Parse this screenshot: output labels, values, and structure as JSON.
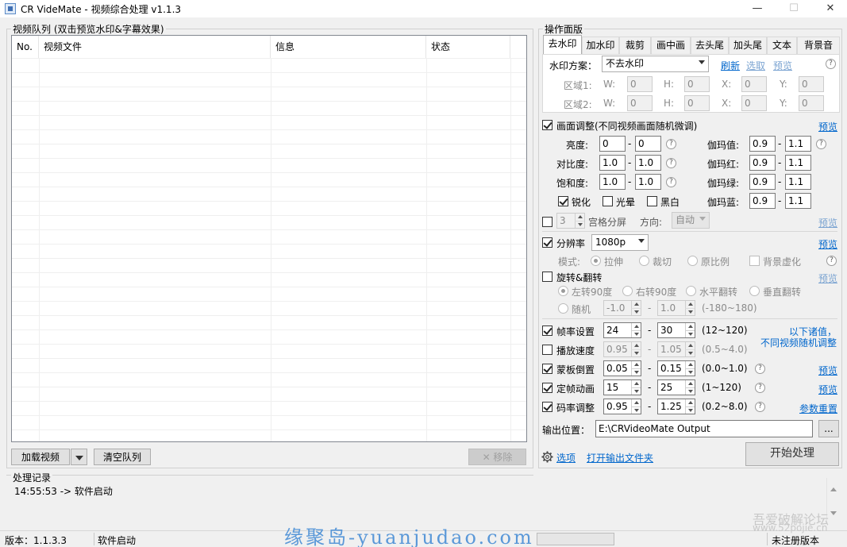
{
  "window": {
    "title": "CR VideMate - 视频综合处理 v1.1.3",
    "minimize": "—",
    "maximize": "☐",
    "close": "✕"
  },
  "queue": {
    "group_label": "视频队列 (双击预览水印&字幕效果)",
    "columns": [
      "No.",
      "视频文件",
      "信息",
      "状态"
    ],
    "load_button": "加载视频",
    "clear_button": "清空队列",
    "remove_button": "✕ 移除"
  },
  "log": {
    "group_label": "处理记录",
    "entries": [
      "14:55:53 -> 软件启动"
    ]
  },
  "status": {
    "version": "版本：1.1.3.3",
    "state": "软件启动",
    "registration": "未注册版本"
  },
  "ops": {
    "group_label": "操作面版",
    "tabs": [
      "去水印",
      "加水印",
      "裁剪",
      "画中画",
      "去头尾",
      "加头尾",
      "文本",
      "背景音"
    ],
    "watermark": {
      "scheme_label": "水印方案：",
      "scheme_value": "不去水印",
      "refresh": "刷新",
      "select": "选取",
      "preview": "预览",
      "region1": "区域1:",
      "region2": "区域2:",
      "w": "W:",
      "h": "H:",
      "x": "X:",
      "y": "Y:",
      "zero": "0"
    },
    "adjust": {
      "label": "画面调整(不同视频画面随机微调)",
      "preview": "预览",
      "brightness": "亮度:",
      "contrast": "对比度:",
      "saturation": "饱和度:",
      "gamma": "伽玛值:",
      "gamma_r": "伽玛红:",
      "gamma_g": "伽玛绿:",
      "gamma_b": "伽玛蓝:",
      "b_min": "0",
      "b_max": "0",
      "c_min": "1.0",
      "c_max": "1.0",
      "s_min": "1.0",
      "s_max": "1.0",
      "g_min": "0.9",
      "g_max": "1.1",
      "sharpen": "锐化",
      "glow": "光晕",
      "bw": "黑白"
    },
    "grid": {
      "value": "3",
      "label": "宫格分屏",
      "direction_label": "方向:",
      "direction_value": "自动",
      "preview": "预览"
    },
    "resolution": {
      "label": "分辨率",
      "value": "1080p",
      "preview": "预览",
      "mode_label": "模式:",
      "stretch": "拉伸",
      "crop": "裁切",
      "original": "原比例",
      "blur": "背景虚化"
    },
    "rotate": {
      "label": "旋转&翻转",
      "preview": "预览",
      "left90": "左转90度",
      "right90": "右转90度",
      "hflip": "水平翻转",
      "vflip": "垂直翻转",
      "random": "随机",
      "r_min": "-1.0",
      "r_max": "1.0",
      "range": "(-180~180)"
    },
    "fps": {
      "label": "帧率设置",
      "min": "24",
      "max": "30",
      "range": "(12~120)"
    },
    "speed": {
      "label": "播放速度",
      "min": "0.95",
      "max": "1.05",
      "range": "(0.5~4.0)"
    },
    "mask": {
      "label": "蒙板倒置",
      "min": "0.05",
      "max": "0.15",
      "range": "(0.0~1.0)",
      "preview": "预览"
    },
    "anim": {
      "label": "定帧动画",
      "min": "15",
      "max": "25",
      "range": "(1~120)",
      "preview": "预览"
    },
    "bitrate": {
      "label": "码率调整",
      "min": "0.95",
      "max": "1.25",
      "range": "(0.2~8.0)",
      "reset": "参数重置"
    },
    "random_note": [
      "以下诸值，",
      "不同视频随机调整"
    ],
    "output": {
      "label": "输出位置：",
      "value": "E:\\CRVideoMate Output",
      "browse": "..."
    },
    "options": "选项",
    "open_output": "打开输出文件夹",
    "start": "开始处理",
    "help": "?"
  },
  "overlay": {
    "watermark": "缘聚岛-yuanjudao.com",
    "watermark2": "吾爱破解论坛",
    "watermark3": "www.52pojie.cn"
  },
  "colors": {
    "link": "#0066cc",
    "accent": "#5a98d8"
  }
}
